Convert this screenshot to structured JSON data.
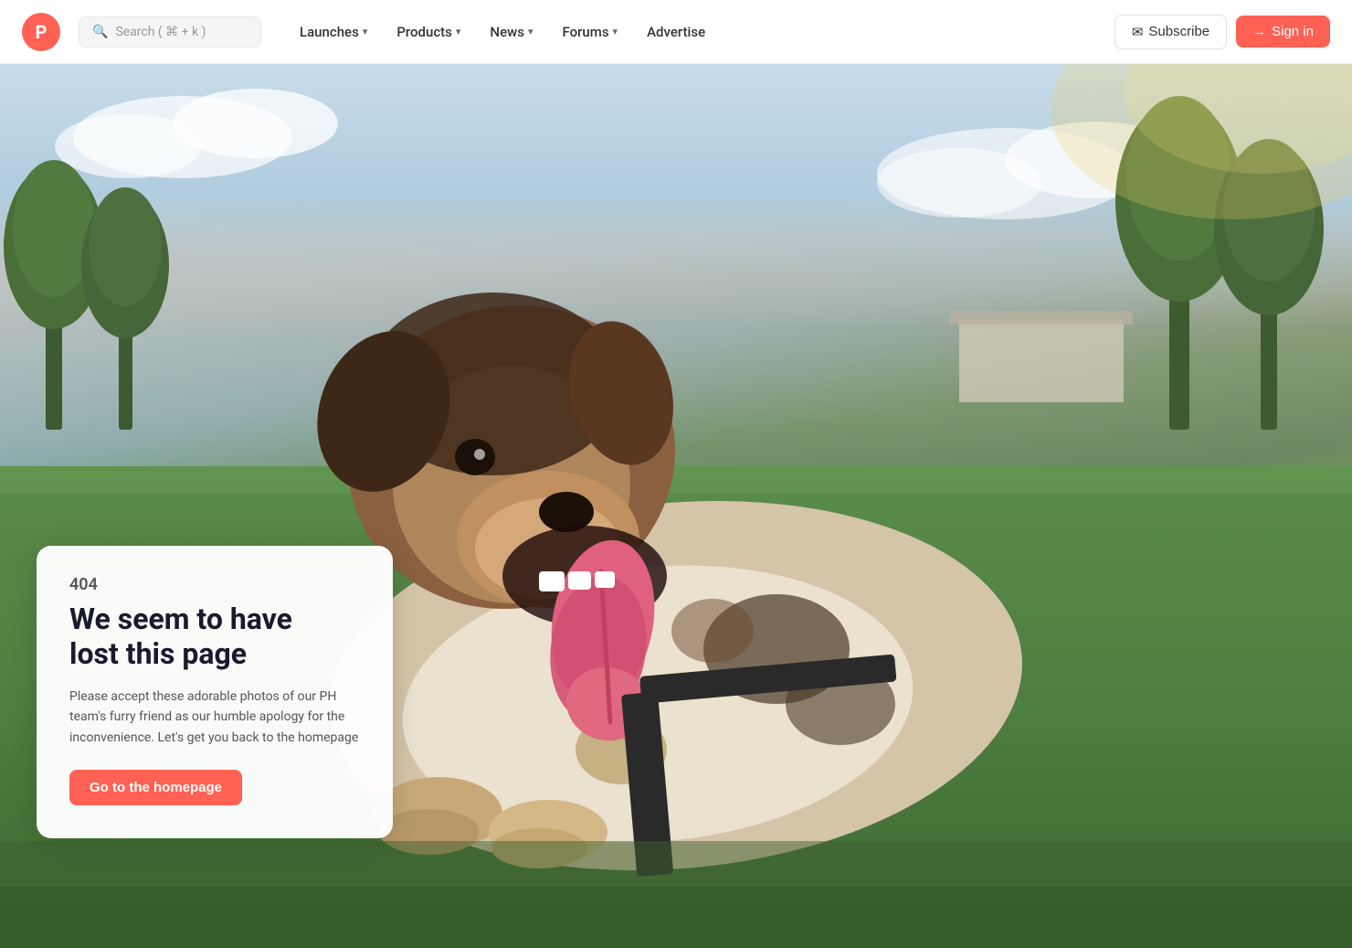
{
  "logo": {
    "letter": "P",
    "bg_color": "#ff6154"
  },
  "search": {
    "placeholder": "Search ( ⌘ + k )",
    "icon": "🔍"
  },
  "nav": {
    "items": [
      {
        "label": "Launches",
        "has_dropdown": true
      },
      {
        "label": "Products",
        "has_dropdown": true
      },
      {
        "label": "News",
        "has_dropdown": true
      },
      {
        "label": "Forums",
        "has_dropdown": true
      },
      {
        "label": "Advertise",
        "has_dropdown": false
      }
    ]
  },
  "nav_right": {
    "subscribe_label": "Subscribe",
    "signin_label": "Sign in"
  },
  "error_page": {
    "error_code": "404",
    "title_line1": "We seem to have",
    "title_line2": "lost this page",
    "description": "Please accept these adorable photos of our PH team's furry friend as our humble apology for the inconvenience. Let's get you back to the homepage",
    "cta_label": "Go to the homepage"
  }
}
